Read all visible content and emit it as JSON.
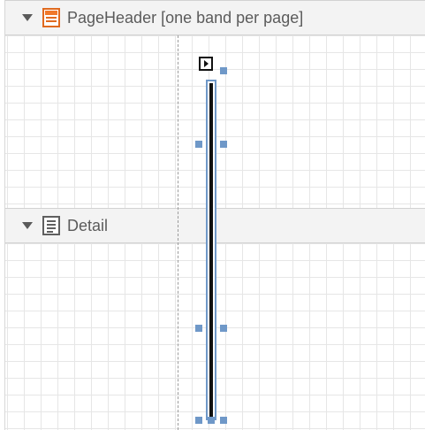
{
  "bands": [
    {
      "title": "PageHeader [one band per page]",
      "icon": "page-header-band-icon"
    },
    {
      "title": "Detail",
      "icon": "detail-band-icon"
    }
  ],
  "colors": {
    "band_background": "#f3f3f3",
    "grid_line": "#e6e6e6",
    "selection_handle": "#6f98c8",
    "header_icon_accent": "#f0782a",
    "control_fill": "#101010"
  }
}
